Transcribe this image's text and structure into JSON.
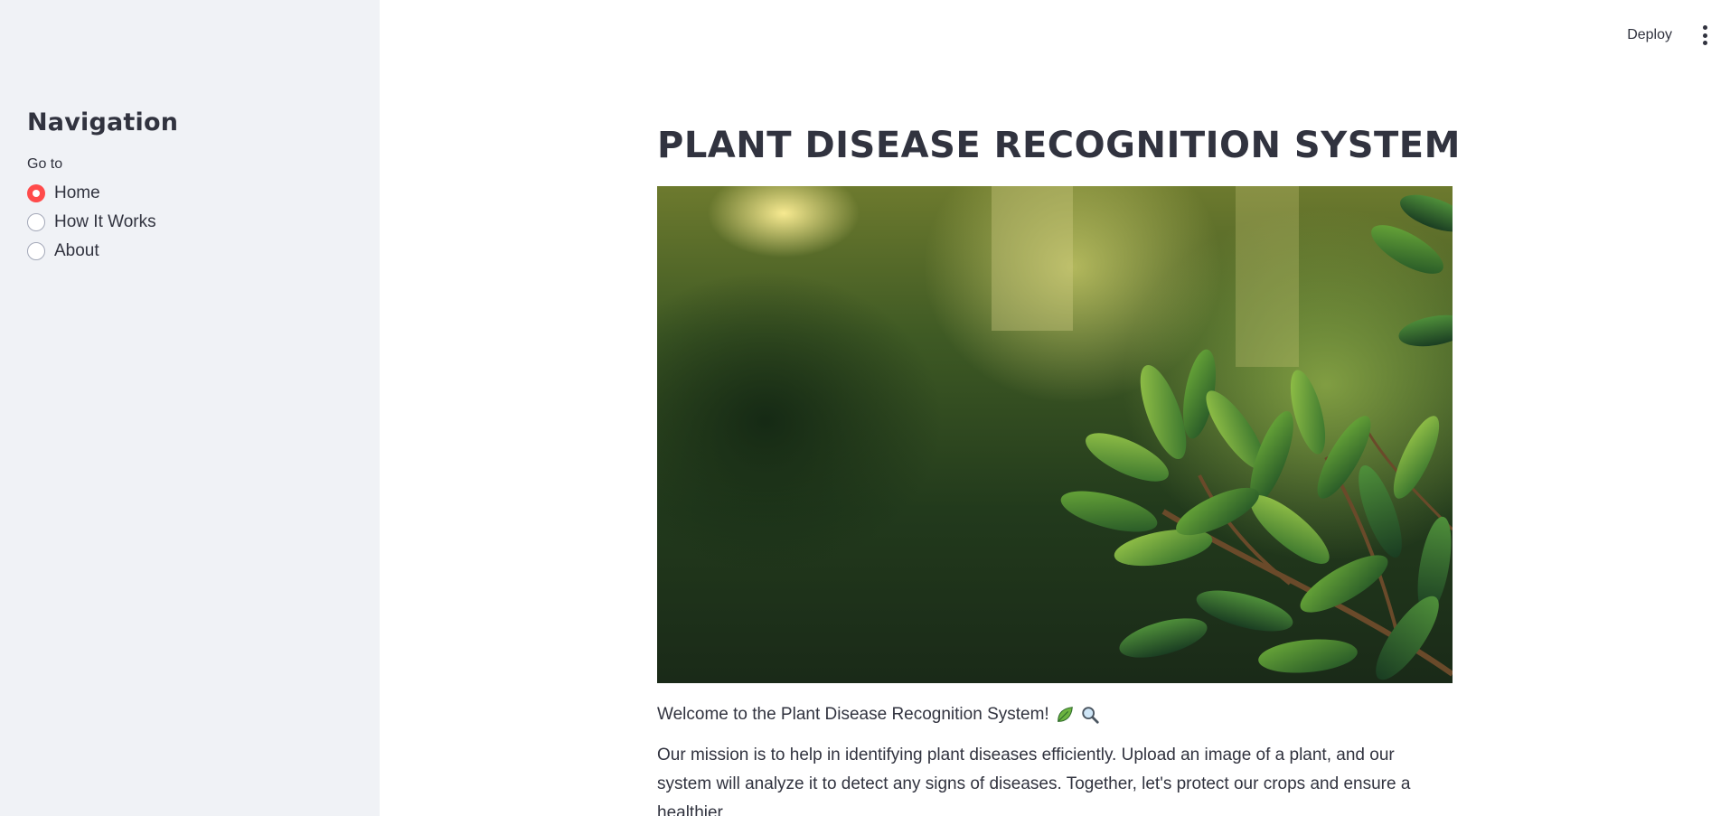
{
  "sidebar": {
    "title": "Navigation",
    "radio_label": "Go to",
    "options": [
      {
        "label": "Home",
        "checked": true
      },
      {
        "label": "How It Works",
        "checked": false
      },
      {
        "label": "About",
        "checked": false
      }
    ]
  },
  "toolbar": {
    "deploy_label": "Deploy",
    "menu_icon": "kebab-menu-icon"
  },
  "main": {
    "title": "PLANT DISEASE RECOGNITION SYSTEM",
    "hero_icon": "plant-leaves-image",
    "welcome_text": "Welcome to the Plant Disease Recognition System!",
    "welcome_icons": [
      "leaf-icon",
      "magnifier-icon"
    ],
    "mission_text": "Our mission is to help in identifying plant diseases efficiently. Upload an image of a plant, and our system will analyze it to detect any signs of diseases. Together, let's protect our crops and ensure a healthier"
  },
  "colors": {
    "accent": "#ff4b4b",
    "sidebar_bg": "#f0f2f6",
    "text": "#31333f"
  }
}
